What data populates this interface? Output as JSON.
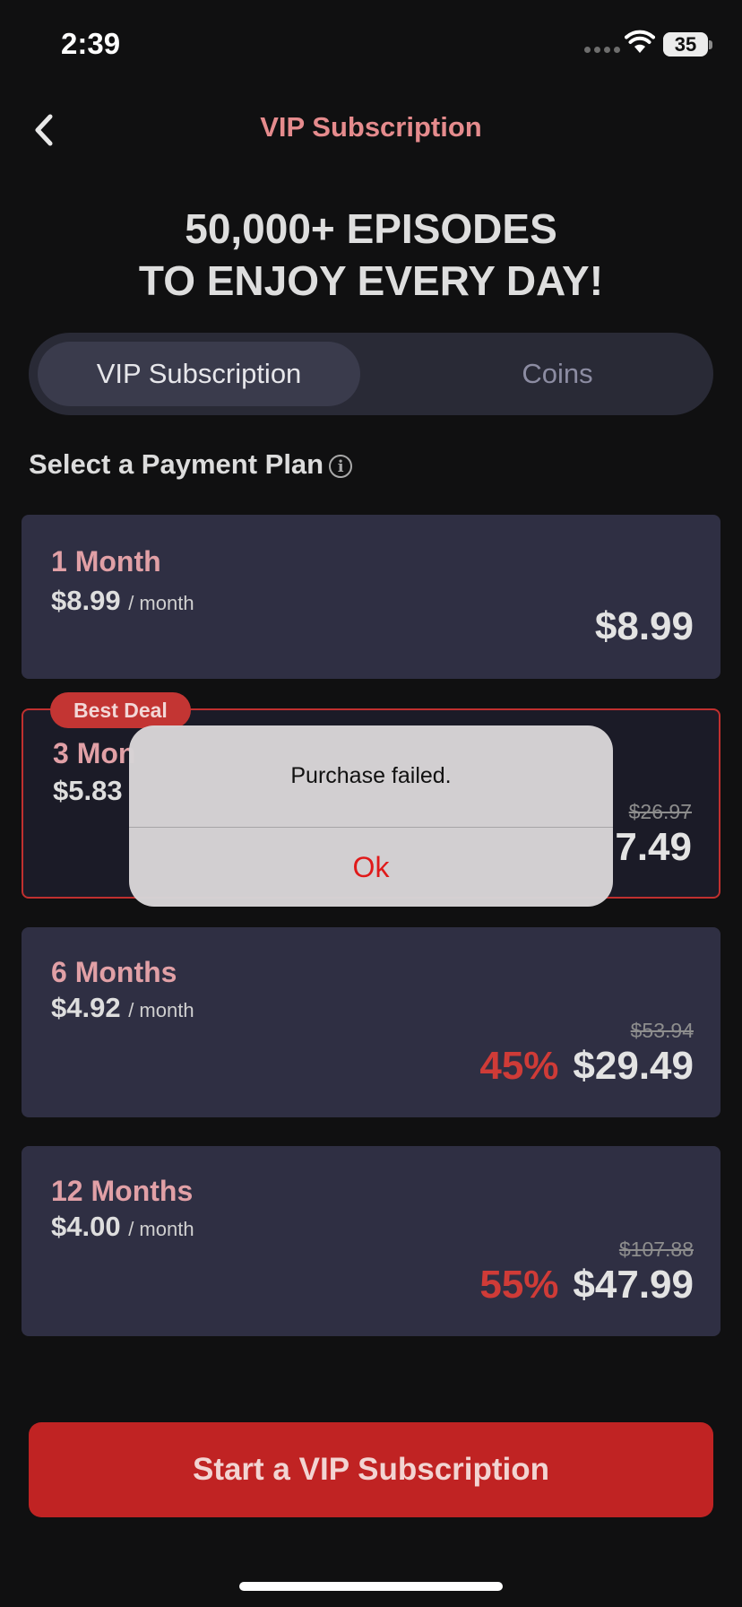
{
  "status_bar": {
    "time": "2:39",
    "battery": "35",
    "battery_level": 0.35
  },
  "nav": {
    "title": "VIP Subscription"
  },
  "headline": {
    "line1": "50,000+ EPISODES",
    "line2": "TO ENJOY EVERY DAY!"
  },
  "tabs": [
    {
      "label": "VIP Subscription",
      "selected": true
    },
    {
      "label": "Coins",
      "selected": false
    }
  ],
  "section_title": "Select a Payment Plan",
  "plans": [
    {
      "name": "1 Month",
      "rate": "$8.99",
      "unit": "/ month",
      "original_price": "",
      "discount": "",
      "price": "$8.99"
    },
    {
      "name": "3 Mon",
      "rate": "$5.83",
      "unit": "",
      "original_price": "$26.97",
      "discount": "",
      "price": "7.49",
      "badge": "Best Deal",
      "selected": true
    },
    {
      "name": "6 Months",
      "rate": "$4.92",
      "unit": "/ month",
      "original_price": "$53.94",
      "discount": "45%",
      "price": "$29.49"
    },
    {
      "name": "12 Months",
      "rate": "$4.00",
      "unit": "/ month",
      "original_price": "$107.88",
      "discount": "55%",
      "price": "$47.99"
    }
  ],
  "cta": {
    "label": "Start a VIP Subscription"
  },
  "alert": {
    "message": "Purchase failed.",
    "button": "Ok"
  },
  "colors": {
    "accent": "#c02323",
    "title": "#e58b8d",
    "alert_button": "#e01a1a"
  },
  "icons": {
    "back": "chevron-left-icon",
    "info": "info-icon",
    "wifi": "wifi-icon"
  }
}
